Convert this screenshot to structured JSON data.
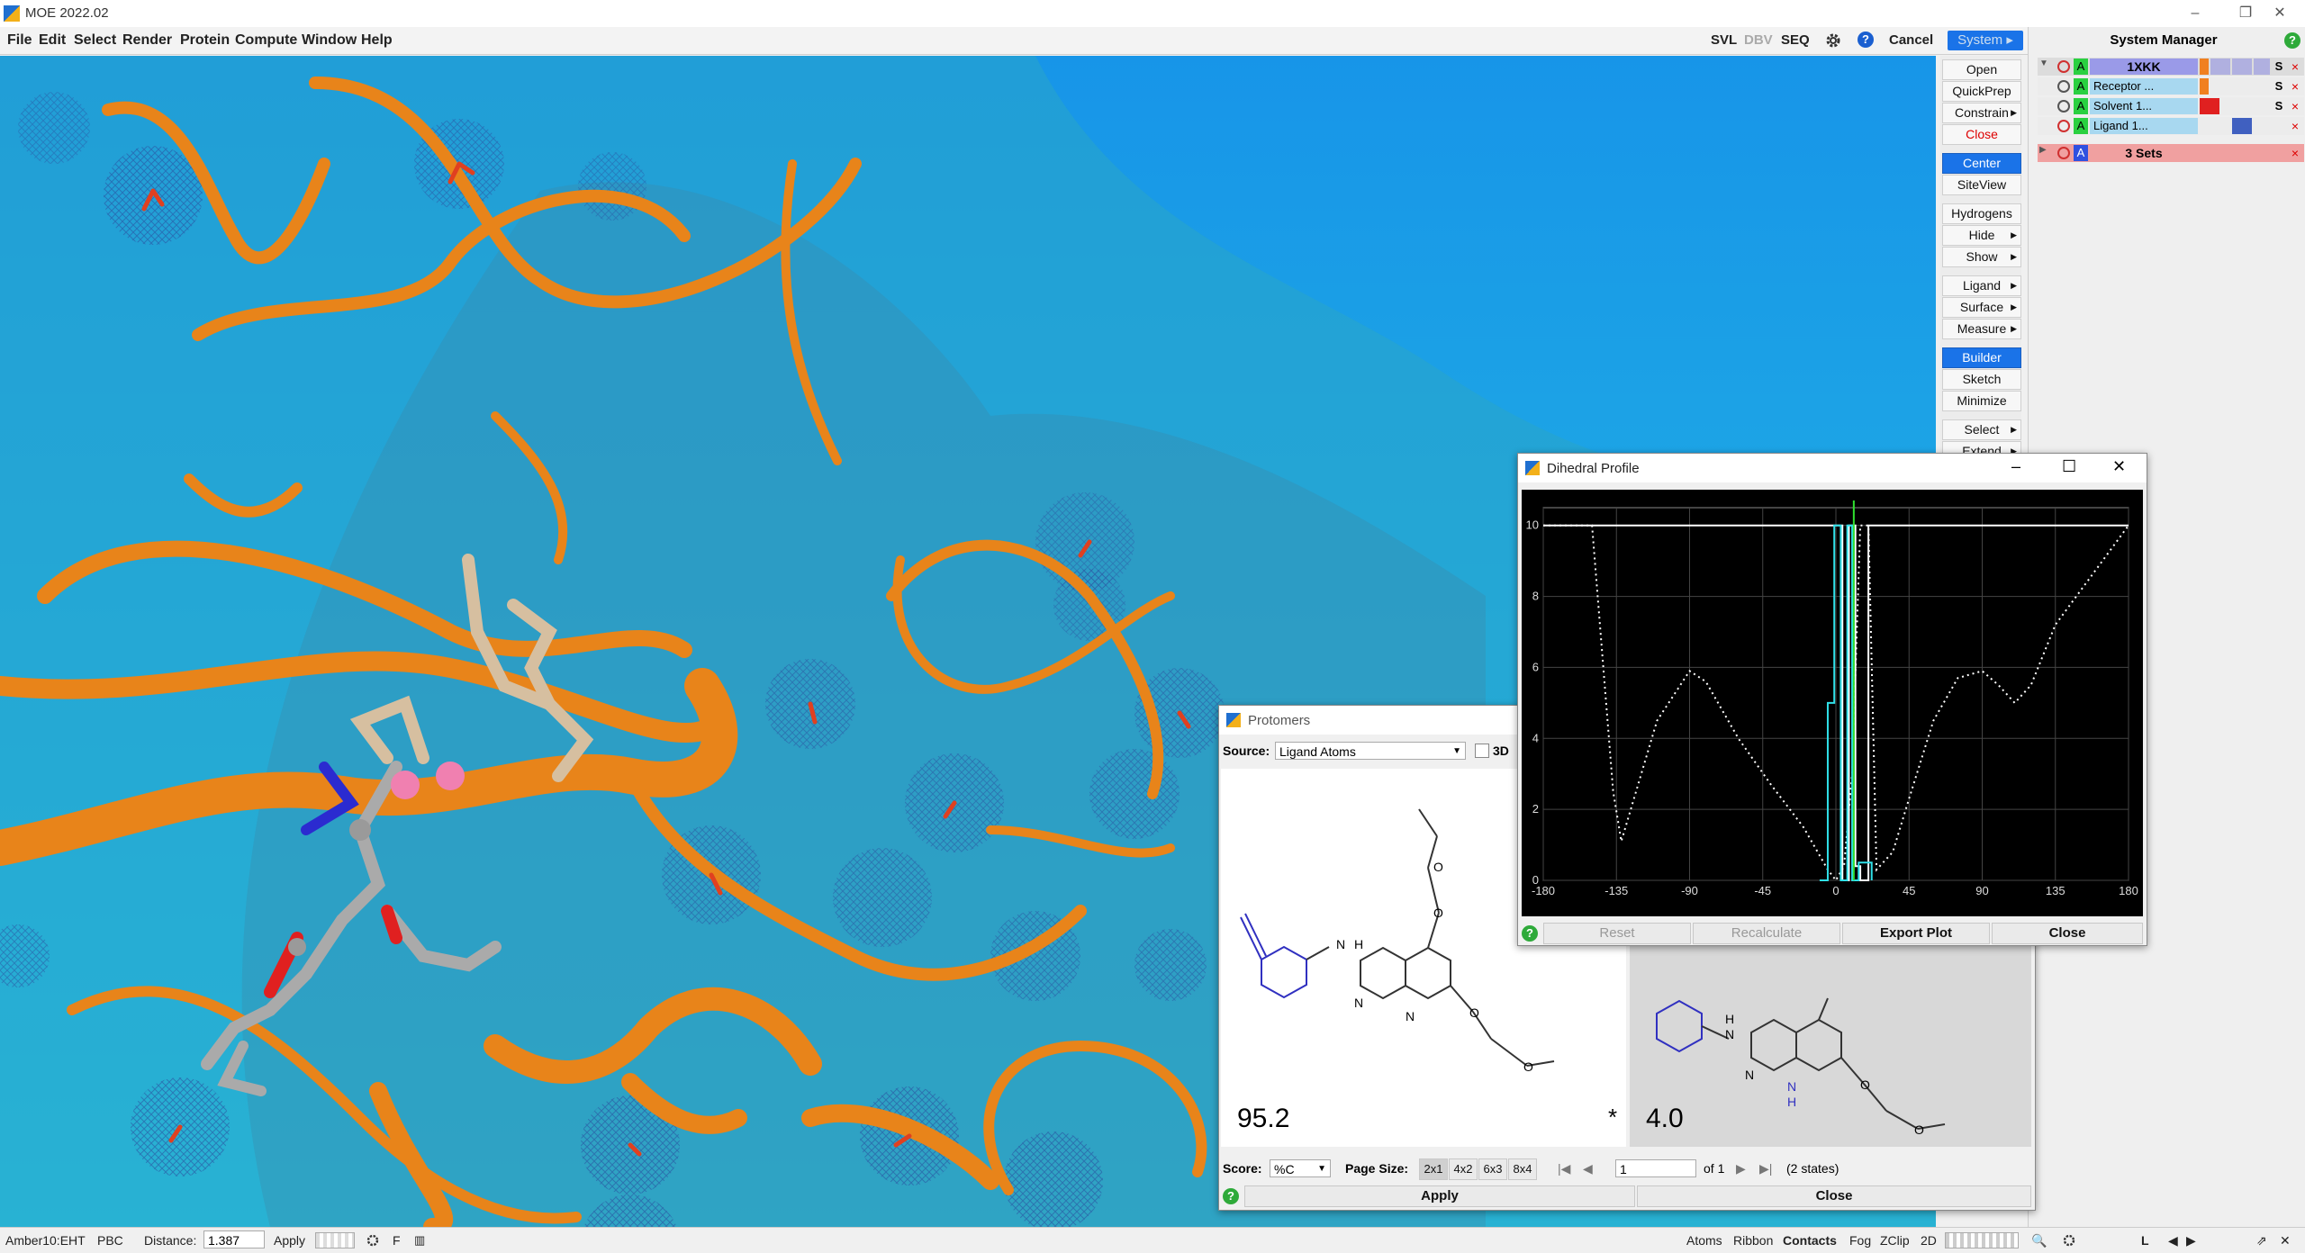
{
  "app": {
    "title": "MOE 2022.02"
  },
  "window_controls": {
    "minimize": "–",
    "restore": "❐",
    "close": "✕"
  },
  "menu": [
    "File",
    "Edit",
    "Select",
    "Render",
    "Protein",
    "Compute",
    "Window",
    "Help"
  ],
  "toolbar": {
    "svl": "SVL",
    "dbv": "DBV",
    "seq": "SEQ",
    "cancel": "Cancel",
    "system": "System"
  },
  "right_buttons": [
    {
      "label": "Open"
    },
    {
      "label": "QuickPrep"
    },
    {
      "label": "Constrain",
      "arrow": true
    },
    {
      "label": "Close",
      "style": "red"
    },
    {
      "label": "Center",
      "style": "blue"
    },
    {
      "label": "SiteView"
    },
    {
      "label": "Hydrogens"
    },
    {
      "label": "Hide",
      "arrow": true
    },
    {
      "label": "Show",
      "arrow": true
    },
    {
      "label": "Ligand",
      "arrow": true
    },
    {
      "label": "Surface",
      "arrow": true
    },
    {
      "label": "Measure",
      "arrow": true
    },
    {
      "label": "Builder",
      "style": "blue"
    },
    {
      "label": "Sketch"
    },
    {
      "label": "Minimize"
    },
    {
      "label": "Select",
      "arrow": true
    },
    {
      "label": "Extend",
      "arrow": true
    }
  ],
  "system_manager": {
    "title": "System Manager",
    "rows": [
      {
        "letter": "A",
        "name": "1XKK",
        "s": "S",
        "x": "×"
      },
      {
        "letter": "A",
        "name": "Receptor ...",
        "s": "S",
        "x": "×"
      },
      {
        "letter": "A",
        "name": "Solvent 1...",
        "s": "S",
        "x": "×"
      },
      {
        "letter": "A",
        "name": "Ligand 1...",
        "s": "S",
        "x": "×"
      }
    ],
    "sets_row": {
      "letter": "A",
      "name": "3 Sets",
      "x": "×"
    }
  },
  "statusbar": {
    "forcefield": "Amber10:EHT",
    "pbc": "PBC",
    "distance_label": "Distance:",
    "distance_value": "1.387",
    "apply": "Apply",
    "f": "F",
    "right": [
      "Atoms",
      "Ribbon",
      "Contacts",
      "Fog",
      "ZClip",
      "2D"
    ],
    "l": "L"
  },
  "protomers": {
    "title": "Protomers",
    "source_label": "Source:",
    "source_value": "Ligand Atoms",
    "three_d": "3D",
    "score1": "95.2",
    "star": "*",
    "score2": "4.0",
    "score_label": "Score:",
    "score_value": "%C",
    "page_size_label": "Page Size:",
    "page_sizes": [
      "2x1",
      "4x2",
      "6x3",
      "8x4"
    ],
    "page_value": "1",
    "of_label": "of 1",
    "states": "(2 states)",
    "apply": "Apply",
    "close": "Close",
    "atom_labels": {
      "n": "N",
      "h": "H",
      "o": "O"
    }
  },
  "dihedral": {
    "title": "Dihedral Profile",
    "buttons": {
      "reset": "Reset",
      "recalculate": "Recalculate",
      "export": "Export Plot",
      "close": "Close"
    }
  },
  "chart_data": {
    "type": "line",
    "xlim": [
      -180,
      180
    ],
    "ylim": [
      0,
      10.5
    ],
    "xticks": [
      -180,
      -135,
      -90,
      -45,
      0,
      45,
      90,
      135,
      180
    ],
    "yticks": [
      0,
      2,
      4,
      6,
      8,
      10
    ],
    "grid": true,
    "series": [
      {
        "style": "dotted-white",
        "x": [
          -180,
          -150,
          -137,
          -132,
          -110,
          -90,
          -80,
          -60,
          -40,
          -20,
          -5,
          0,
          5,
          10,
          15,
          20,
          25,
          35,
          45,
          60,
          75,
          90,
          100,
          110,
          120,
          135,
          180
        ],
        "y": [
          10,
          10,
          2.5,
          1.1,
          4.5,
          5.9,
          5.6,
          4.0,
          2.7,
          1.5,
          0.3,
          0,
          0.4,
          3.0,
          10,
          10,
          0.3,
          0.8,
          2.3,
          4.5,
          5.7,
          5.9,
          5.5,
          5.0,
          5.5,
          7.2,
          10
        ]
      },
      {
        "style": "solid-white",
        "x": [
          -180,
          4,
          4,
          8,
          8,
          12,
          12,
          15,
          15,
          20,
          20,
          180
        ],
        "y": [
          10,
          10,
          0,
          0,
          10,
          10,
          0.4,
          0.4,
          0,
          0,
          10,
          10
        ]
      },
      {
        "style": "cyan-steps",
        "x": [
          -10,
          -5,
          -5,
          -1,
          -1,
          3,
          3,
          7,
          7,
          10,
          10,
          14,
          14,
          22,
          22
        ],
        "y": [
          0,
          0,
          5,
          5,
          10,
          10,
          0,
          0,
          10,
          10,
          0,
          0,
          0.5,
          0.5,
          0
        ]
      }
    ],
    "marker_x": 11
  }
}
